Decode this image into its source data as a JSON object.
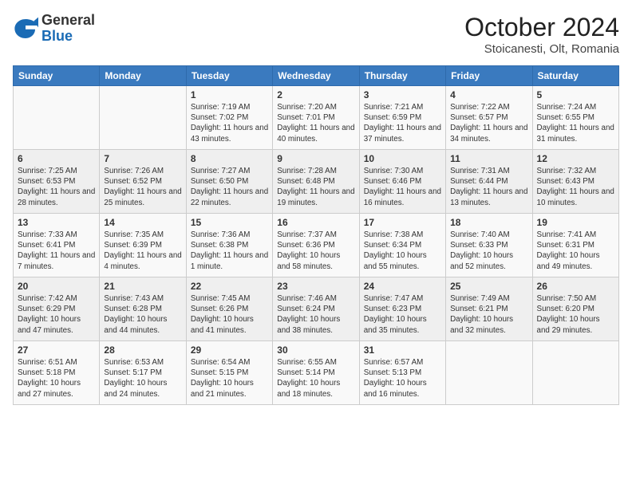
{
  "logo": {
    "general": "General",
    "blue": "Blue"
  },
  "title": "October 2024",
  "location": "Stoicanesti, Olt, Romania",
  "days_of_week": [
    "Sunday",
    "Monday",
    "Tuesday",
    "Wednesday",
    "Thursday",
    "Friday",
    "Saturday"
  ],
  "weeks": [
    [
      {
        "day": "",
        "info": ""
      },
      {
        "day": "",
        "info": ""
      },
      {
        "day": "1",
        "info": "Sunrise: 7:19 AM\nSunset: 7:02 PM\nDaylight: 11 hours and 43 minutes."
      },
      {
        "day": "2",
        "info": "Sunrise: 7:20 AM\nSunset: 7:01 PM\nDaylight: 11 hours and 40 minutes."
      },
      {
        "day": "3",
        "info": "Sunrise: 7:21 AM\nSunset: 6:59 PM\nDaylight: 11 hours and 37 minutes."
      },
      {
        "day": "4",
        "info": "Sunrise: 7:22 AM\nSunset: 6:57 PM\nDaylight: 11 hours and 34 minutes."
      },
      {
        "day": "5",
        "info": "Sunrise: 7:24 AM\nSunset: 6:55 PM\nDaylight: 11 hours and 31 minutes."
      }
    ],
    [
      {
        "day": "6",
        "info": "Sunrise: 7:25 AM\nSunset: 6:53 PM\nDaylight: 11 hours and 28 minutes."
      },
      {
        "day": "7",
        "info": "Sunrise: 7:26 AM\nSunset: 6:52 PM\nDaylight: 11 hours and 25 minutes."
      },
      {
        "day": "8",
        "info": "Sunrise: 7:27 AM\nSunset: 6:50 PM\nDaylight: 11 hours and 22 minutes."
      },
      {
        "day": "9",
        "info": "Sunrise: 7:28 AM\nSunset: 6:48 PM\nDaylight: 11 hours and 19 minutes."
      },
      {
        "day": "10",
        "info": "Sunrise: 7:30 AM\nSunset: 6:46 PM\nDaylight: 11 hours and 16 minutes."
      },
      {
        "day": "11",
        "info": "Sunrise: 7:31 AM\nSunset: 6:44 PM\nDaylight: 11 hours and 13 minutes."
      },
      {
        "day": "12",
        "info": "Sunrise: 7:32 AM\nSunset: 6:43 PM\nDaylight: 11 hours and 10 minutes."
      }
    ],
    [
      {
        "day": "13",
        "info": "Sunrise: 7:33 AM\nSunset: 6:41 PM\nDaylight: 11 hours and 7 minutes."
      },
      {
        "day": "14",
        "info": "Sunrise: 7:35 AM\nSunset: 6:39 PM\nDaylight: 11 hours and 4 minutes."
      },
      {
        "day": "15",
        "info": "Sunrise: 7:36 AM\nSunset: 6:38 PM\nDaylight: 11 hours and 1 minute."
      },
      {
        "day": "16",
        "info": "Sunrise: 7:37 AM\nSunset: 6:36 PM\nDaylight: 10 hours and 58 minutes."
      },
      {
        "day": "17",
        "info": "Sunrise: 7:38 AM\nSunset: 6:34 PM\nDaylight: 10 hours and 55 minutes."
      },
      {
        "day": "18",
        "info": "Sunrise: 7:40 AM\nSunset: 6:33 PM\nDaylight: 10 hours and 52 minutes."
      },
      {
        "day": "19",
        "info": "Sunrise: 7:41 AM\nSunset: 6:31 PM\nDaylight: 10 hours and 49 minutes."
      }
    ],
    [
      {
        "day": "20",
        "info": "Sunrise: 7:42 AM\nSunset: 6:29 PM\nDaylight: 10 hours and 47 minutes."
      },
      {
        "day": "21",
        "info": "Sunrise: 7:43 AM\nSunset: 6:28 PM\nDaylight: 10 hours and 44 minutes."
      },
      {
        "day": "22",
        "info": "Sunrise: 7:45 AM\nSunset: 6:26 PM\nDaylight: 10 hours and 41 minutes."
      },
      {
        "day": "23",
        "info": "Sunrise: 7:46 AM\nSunset: 6:24 PM\nDaylight: 10 hours and 38 minutes."
      },
      {
        "day": "24",
        "info": "Sunrise: 7:47 AM\nSunset: 6:23 PM\nDaylight: 10 hours and 35 minutes."
      },
      {
        "day": "25",
        "info": "Sunrise: 7:49 AM\nSunset: 6:21 PM\nDaylight: 10 hours and 32 minutes."
      },
      {
        "day": "26",
        "info": "Sunrise: 7:50 AM\nSunset: 6:20 PM\nDaylight: 10 hours and 29 minutes."
      }
    ],
    [
      {
        "day": "27",
        "info": "Sunrise: 6:51 AM\nSunset: 5:18 PM\nDaylight: 10 hours and 27 minutes."
      },
      {
        "day": "28",
        "info": "Sunrise: 6:53 AM\nSunset: 5:17 PM\nDaylight: 10 hours and 24 minutes."
      },
      {
        "day": "29",
        "info": "Sunrise: 6:54 AM\nSunset: 5:15 PM\nDaylight: 10 hours and 21 minutes."
      },
      {
        "day": "30",
        "info": "Sunrise: 6:55 AM\nSunset: 5:14 PM\nDaylight: 10 hours and 18 minutes."
      },
      {
        "day": "31",
        "info": "Sunrise: 6:57 AM\nSunset: 5:13 PM\nDaylight: 10 hours and 16 minutes."
      },
      {
        "day": "",
        "info": ""
      },
      {
        "day": "",
        "info": ""
      }
    ]
  ]
}
